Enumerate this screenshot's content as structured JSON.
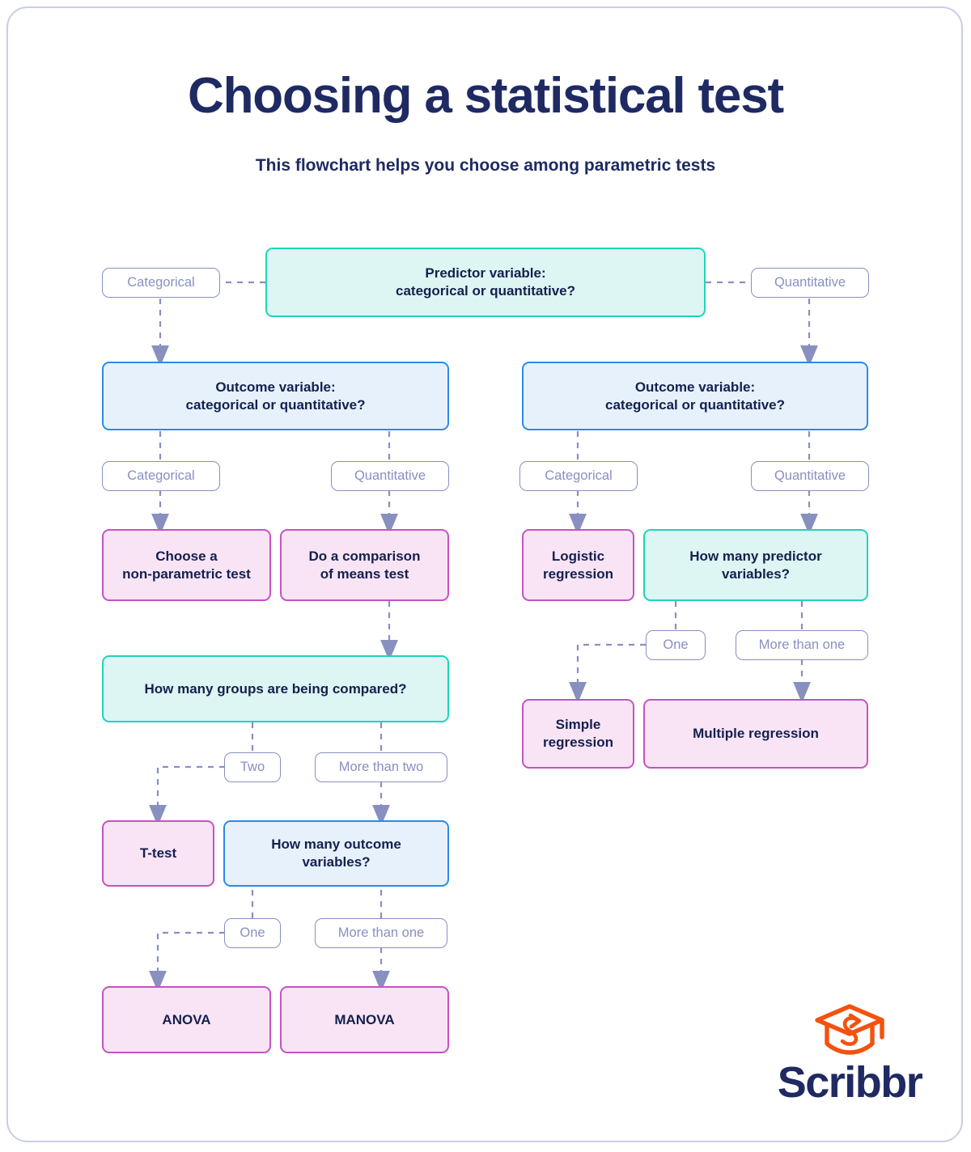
{
  "header": {
    "title": "Choosing a statistical test",
    "subtitle": "This flowchart helps you choose among parametric tests"
  },
  "brand": {
    "name": "Scribbr",
    "logo_icon": "graduation-cap-icon",
    "logo_color": "#f4510f",
    "wordmark_color": "#1f2a63"
  },
  "colors": {
    "title": "#1f2a63",
    "node_text": "#14204e",
    "teal_fill": "#ddf5f3",
    "teal_border": "#1ed4bb",
    "blue_fill": "#e6f1fc",
    "blue_border": "#2b8ae8",
    "pink_fill": "#f9e4f6",
    "pink_border": "#c653c0",
    "pill_border": "#8890c0",
    "pill_text": "#8890c0",
    "connector": "#8890c0",
    "frame_border": "#c8cee4"
  },
  "nodes": {
    "predictor_variable": "Predictor variable:\ncategorical or quantitative?",
    "outcome_variable_left": "Outcome variable:\ncategorical or quantitative?",
    "outcome_variable_right": "Outcome variable:\ncategorical or quantitative?",
    "non_parametric": "Choose a\nnon-parametric test",
    "comparison_of_means": "Do a comparison\nof means test",
    "logistic_regression": "Logistic\nregression",
    "how_many_predictors": "How many predictor\nvariables?",
    "simple_regression": "Simple\nregression",
    "multiple_regression": "Multiple regression",
    "how_many_groups": "How many groups are being compared?",
    "t_test": "T-test",
    "how_many_outcomes": "How many outcome\nvariables?",
    "anova": "ANOVA",
    "manova": "MANOVA"
  },
  "edge_labels": {
    "predictor_categorical": "Categorical",
    "predictor_quantitative": "Quantitative",
    "outcome_left_categorical": "Categorical",
    "outcome_left_quantitative": "Quantitative",
    "outcome_right_categorical": "Categorical",
    "outcome_right_quantitative": "Quantitative",
    "predictors_one": "One",
    "predictors_more_than_one": "More than one",
    "groups_two": "Two",
    "groups_more_than_two": "More than two",
    "outcomes_one": "One",
    "outcomes_more_than_one": "More than one"
  },
  "chart_data": {
    "type": "flowchart",
    "title": "Choosing a statistical test",
    "subtitle": "This flowchart helps you choose among parametric tests",
    "node_kinds": {
      "teal": "decision / question (primary)",
      "blue": "decision / question (secondary)",
      "pink": "terminal result / recommended test"
    },
    "nodes": [
      {
        "id": "predictor_variable",
        "label": "Predictor variable: categorical or quantitative?",
        "kind": "teal"
      },
      {
        "id": "outcome_variable_left",
        "label": "Outcome variable: categorical or quantitative?",
        "kind": "blue"
      },
      {
        "id": "outcome_variable_right",
        "label": "Outcome variable: categorical or quantitative?",
        "kind": "blue"
      },
      {
        "id": "non_parametric",
        "label": "Choose a non-parametric test",
        "kind": "pink"
      },
      {
        "id": "comparison_of_means",
        "label": "Do a comparison of means test",
        "kind": "pink"
      },
      {
        "id": "how_many_groups",
        "label": "How many groups are being compared?",
        "kind": "teal"
      },
      {
        "id": "t_test",
        "label": "T-test",
        "kind": "pink"
      },
      {
        "id": "how_many_outcomes",
        "label": "How many outcome variables?",
        "kind": "blue"
      },
      {
        "id": "anova",
        "label": "ANOVA",
        "kind": "pink"
      },
      {
        "id": "manova",
        "label": "MANOVA",
        "kind": "pink"
      },
      {
        "id": "logistic_regression",
        "label": "Logistic regression",
        "kind": "pink"
      },
      {
        "id": "how_many_predictors",
        "label": "How many predictor variables?",
        "kind": "teal"
      },
      {
        "id": "simple_regression",
        "label": "Simple regression",
        "kind": "pink"
      },
      {
        "id": "multiple_regression",
        "label": "Multiple regression",
        "kind": "pink"
      }
    ],
    "edges": [
      {
        "from": "predictor_variable",
        "to": "outcome_variable_left",
        "label": "Categorical"
      },
      {
        "from": "predictor_variable",
        "to": "outcome_variable_right",
        "label": "Quantitative"
      },
      {
        "from": "outcome_variable_left",
        "to": "non_parametric",
        "label": "Categorical"
      },
      {
        "from": "outcome_variable_left",
        "to": "comparison_of_means",
        "label": "Quantitative"
      },
      {
        "from": "comparison_of_means",
        "to": "how_many_groups",
        "label": ""
      },
      {
        "from": "how_many_groups",
        "to": "t_test",
        "label": "Two"
      },
      {
        "from": "how_many_groups",
        "to": "how_many_outcomes",
        "label": "More than two"
      },
      {
        "from": "how_many_outcomes",
        "to": "anova",
        "label": "One"
      },
      {
        "from": "how_many_outcomes",
        "to": "manova",
        "label": "More than one"
      },
      {
        "from": "outcome_variable_right",
        "to": "logistic_regression",
        "label": "Categorical"
      },
      {
        "from": "outcome_variable_right",
        "to": "how_many_predictors",
        "label": "Quantitative"
      },
      {
        "from": "how_many_predictors",
        "to": "simple_regression",
        "label": "One"
      },
      {
        "from": "how_many_predictors",
        "to": "multiple_regression",
        "label": "More than one"
      }
    ]
  }
}
